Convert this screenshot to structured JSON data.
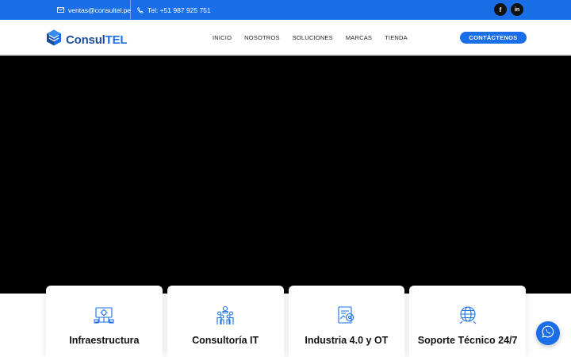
{
  "topbar": {
    "email": "ventas@consultel.pe",
    "phone": "Tel: +51 987 925 751",
    "social": {
      "facebook": "f",
      "linkedin": "in"
    }
  },
  "logo": {
    "part1": "Consul",
    "part2": "TEL"
  },
  "nav": {
    "items": [
      "INICIO",
      "NOSOTROS",
      "SOLUCIONES",
      "MARCAS",
      "TIENDA"
    ],
    "cta": "CONTÁCTENOS"
  },
  "cards": [
    {
      "title": "Infraestructura",
      "icon": "network-icon"
    },
    {
      "title": "Consultoría IT",
      "icon": "team-icon"
    },
    {
      "title": "Industria 4.0 y OT",
      "icon": "automation-icon"
    },
    {
      "title": "Soporte Técnico 24/7",
      "icon": "globe-icon"
    }
  ],
  "colors": {
    "primary": "#1a6fe8",
    "logo_dark": "#1e4c9a",
    "hero": "#000000"
  }
}
